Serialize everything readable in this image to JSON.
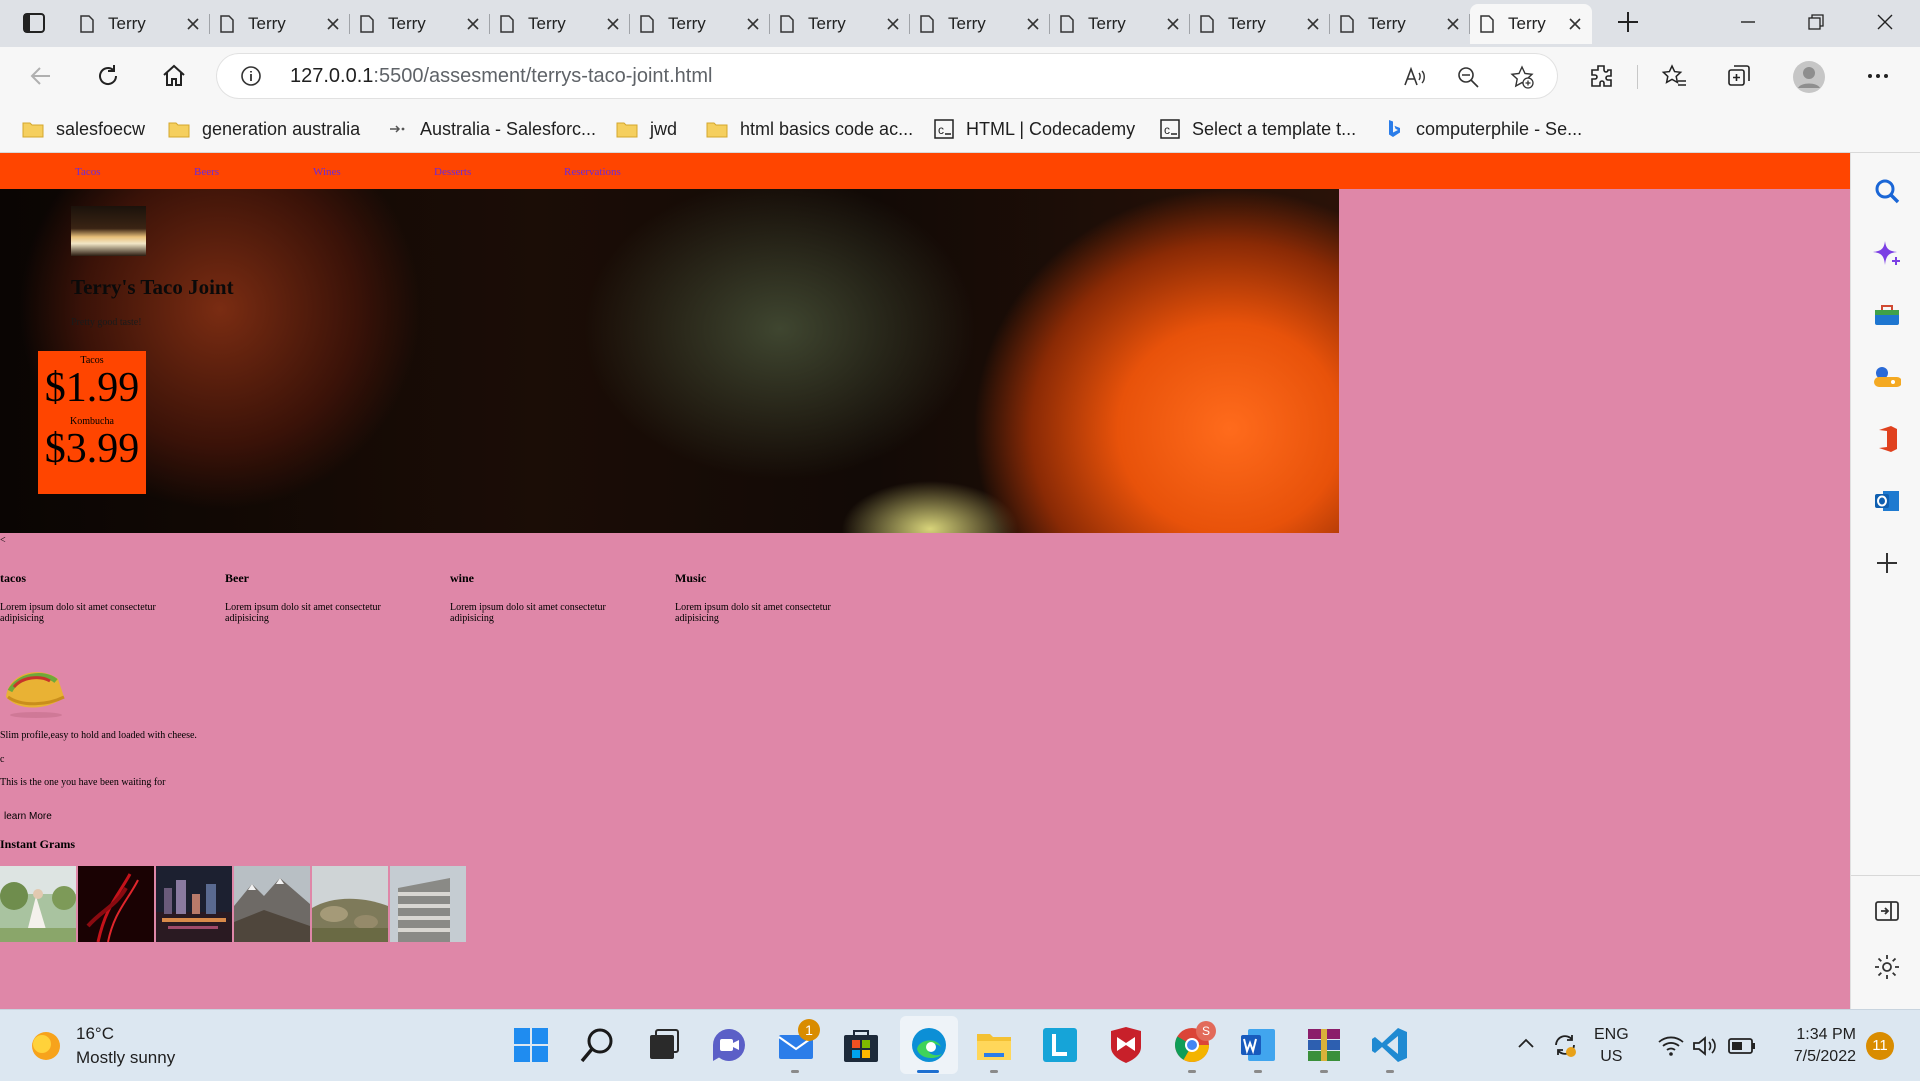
{
  "browser": {
    "tabs": [
      {
        "label": "Terry"
      },
      {
        "label": "Terry"
      },
      {
        "label": "Terry"
      },
      {
        "label": "Terry"
      },
      {
        "label": "Terry"
      },
      {
        "label": "Terry"
      },
      {
        "label": "Terry"
      },
      {
        "label": "Terry"
      },
      {
        "label": "Terry"
      },
      {
        "label": "Terry"
      },
      {
        "label": "Terry"
      }
    ],
    "url_host": "127.0.0.1",
    "url_path": ":5500/assesment/terrys-taco-joint.html",
    "bookmarks": [
      {
        "label": "salesfoecw",
        "icon": "folder-icon"
      },
      {
        "label": "generation australia",
        "icon": "folder-icon"
      },
      {
        "label": "Australia - Salesforc...",
        "icon": "salesforce-icon"
      },
      {
        "label": "jwd",
        "icon": "folder-icon"
      },
      {
        "label": "html basics code ac...",
        "icon": "folder-icon"
      },
      {
        "label": "HTML | Codecademy",
        "icon": "codecademy-icon"
      },
      {
        "label": "Select a template t...",
        "icon": "codecademy-icon"
      },
      {
        "label": "computerphile - Se...",
        "icon": "bing-icon"
      }
    ]
  },
  "site": {
    "nav": [
      "Tacos",
      "Beers",
      "Wines",
      "Desserts",
      "Reservations"
    ],
    "title": "Terry's Taco Joint",
    "tagline": "Pretty good taste!",
    "prices": [
      {
        "label": "Tacos",
        "value": "$1.99"
      },
      {
        "label": "Kombucha",
        "value": "$3.99"
      }
    ],
    "stray_lt": "<",
    "features": [
      {
        "title": "tacos",
        "text": "Lorem ipsum dolo sit amet consectetur adipisicing"
      },
      {
        "title": "Beer",
        "text": "Lorem ipsum dolo sit amet consectetur adipisicing"
      },
      {
        "title": "wine",
        "text": "Lorem ipsum dolo sit amet consectetur adipisicing"
      },
      {
        "title": "Music",
        "text": "Lorem ipsum dolo sit amet consectetur adipisicing"
      }
    ],
    "taco_caption": "Slim profile,easy to hold and loaded with cheese.",
    "stray_c": "c",
    "waiting_text": "This is the one you have been waiting for",
    "learn_more": "learn More",
    "grams_title": "Instant Grams"
  },
  "taskbar": {
    "temperature": "16°C",
    "condition": "Mostly sunny",
    "mail_badge": "1",
    "chrome_badge": "S",
    "language_top": "ENG",
    "language_bottom": "US",
    "time": "1:34 PM",
    "date": "7/5/2022",
    "notifications": "11"
  },
  "colors": {
    "nav_bg": "#ff4500",
    "page_bg": "#df87a8",
    "nav_link": "#6b2bd8"
  }
}
